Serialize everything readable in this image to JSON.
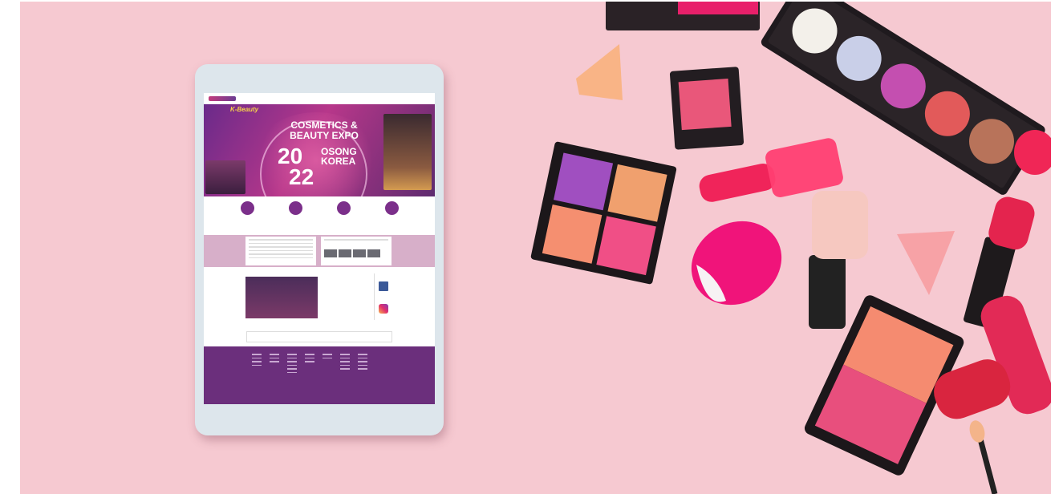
{
  "banner": {
    "title_line1": "COSMETICS &",
    "title_line2": "BEAUTY EXPO",
    "year": "20",
    "year2": "22",
    "location": "OSONG",
    "country": "KOREA",
    "slogan": "K-Beauty"
  },
  "colors": {
    "background": "#f6c9d1",
    "brand_purple": "#6b2f7c",
    "accent_pink": "#b7378a"
  }
}
